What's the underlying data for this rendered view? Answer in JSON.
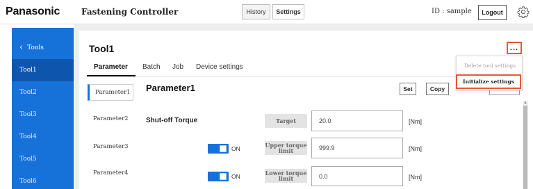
{
  "header": {
    "brand": "Panasonic",
    "app_title": "Fastening Controller",
    "history_label": "History",
    "settings_label": "Settings",
    "user_id": "ID : sample",
    "logout_label": "Logout",
    "gear_icon": "gear-icon"
  },
  "sidebar": {
    "back_label": "Tools",
    "items": [
      "Tool1",
      "Tool2",
      "Tool3",
      "Tool4",
      "Tool5",
      "Tool6"
    ],
    "active_index": 0,
    "accent_color": "#1672d8"
  },
  "main": {
    "tool_title": "Tool1",
    "more_label": "...",
    "tabs": [
      "Parameter",
      "Batch",
      "Job",
      "Device settings"
    ],
    "active_tab": 0,
    "menu": {
      "delete_label": "Delete tool settings",
      "initialize_label": "Initialize settings"
    },
    "parameter_list": [
      "Parameter1",
      "Parameter2",
      "Parameter3",
      "Parameter4"
    ],
    "active_parameter": 0,
    "heading": "Parameter1",
    "set_label": "Set",
    "copy_label": "Copy",
    "section_label": "Shut-off Torque",
    "fields": [
      {
        "label": "Target",
        "value": "20.0",
        "unit": "[Nm]",
        "toggle": null
      },
      {
        "label": "Upper torque limit",
        "value": "999.9",
        "unit": "[Nm]",
        "toggle": "ON"
      },
      {
        "label": "Lower torque limit",
        "value": "0.0",
        "unit": "[Nm]",
        "toggle": "ON"
      }
    ]
  }
}
